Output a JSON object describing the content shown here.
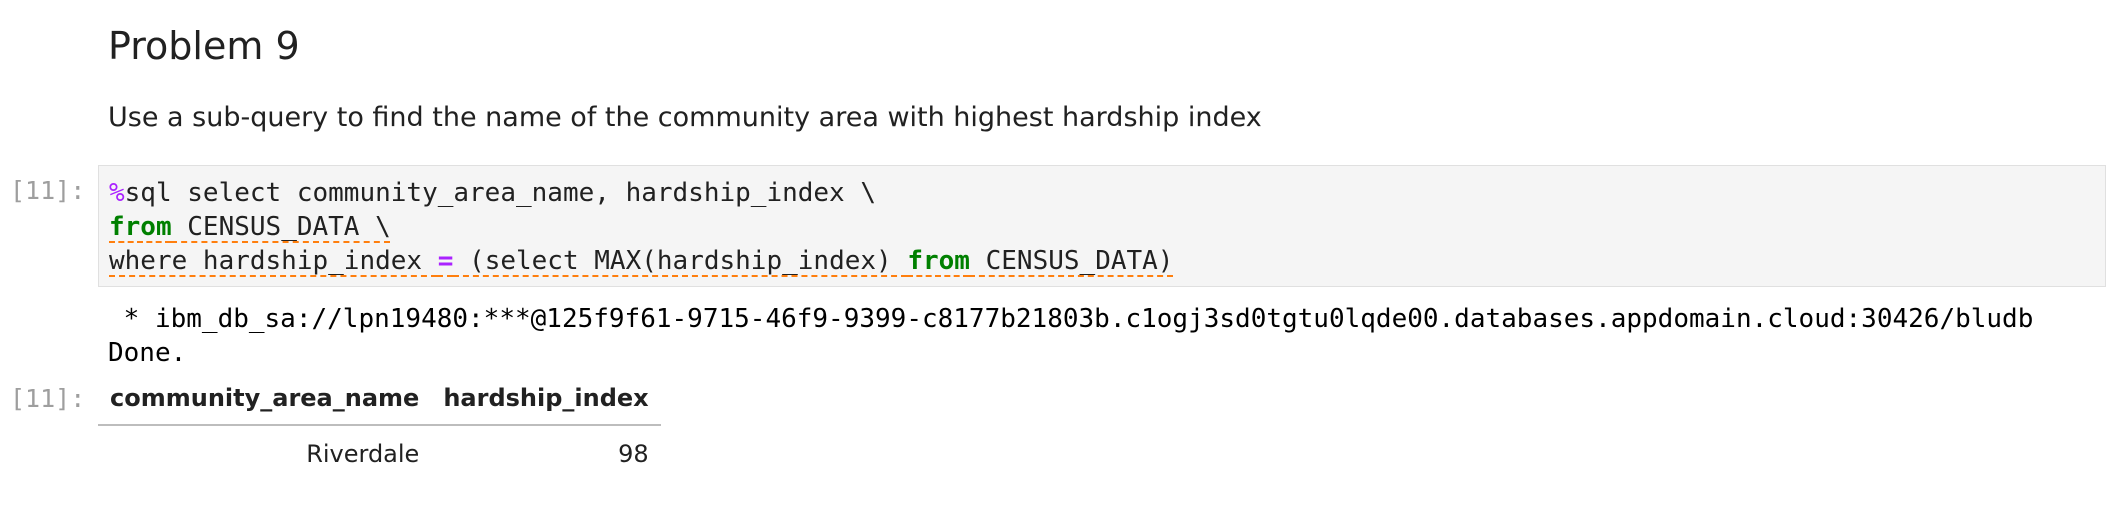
{
  "markdown": {
    "heading": "Problem 9",
    "description": "Use a sub-query to find the name of the community area with highest hardship index"
  },
  "code_cell": {
    "prompt": "[11]:",
    "lines": [
      {
        "magic": "%",
        "rest": "sql select community_area_name, hardship_index \\"
      },
      {
        "kw": "from",
        "rest": " CENSUS_DATA \\"
      },
      {
        "a": "where hardship_index ",
        "op": "=",
        "b": " (select MAX(hardship_index) ",
        "kw": "from",
        "c": " CENSUS_DATA)"
      }
    ]
  },
  "output": {
    "stream_line1": " * ibm_db_sa://lpn19480:***@125f9f61-9715-46f9-9399-c8177b21803b.c1ogj3sd0tgtu0lqde00.databases.appdomain.cloud:30426/bludb",
    "stream_line2": "Done.",
    "prompt": "[11]:",
    "table": {
      "headers": [
        "community_area_name",
        "hardship_index"
      ],
      "rows": [
        [
          "Riverdale",
          "98"
        ]
      ]
    }
  },
  "colors": {
    "keyword": "#008000",
    "magic": "#aa22ff",
    "squiggle": "#ff7f0e",
    "prompt": "#9e9e9e"
  }
}
